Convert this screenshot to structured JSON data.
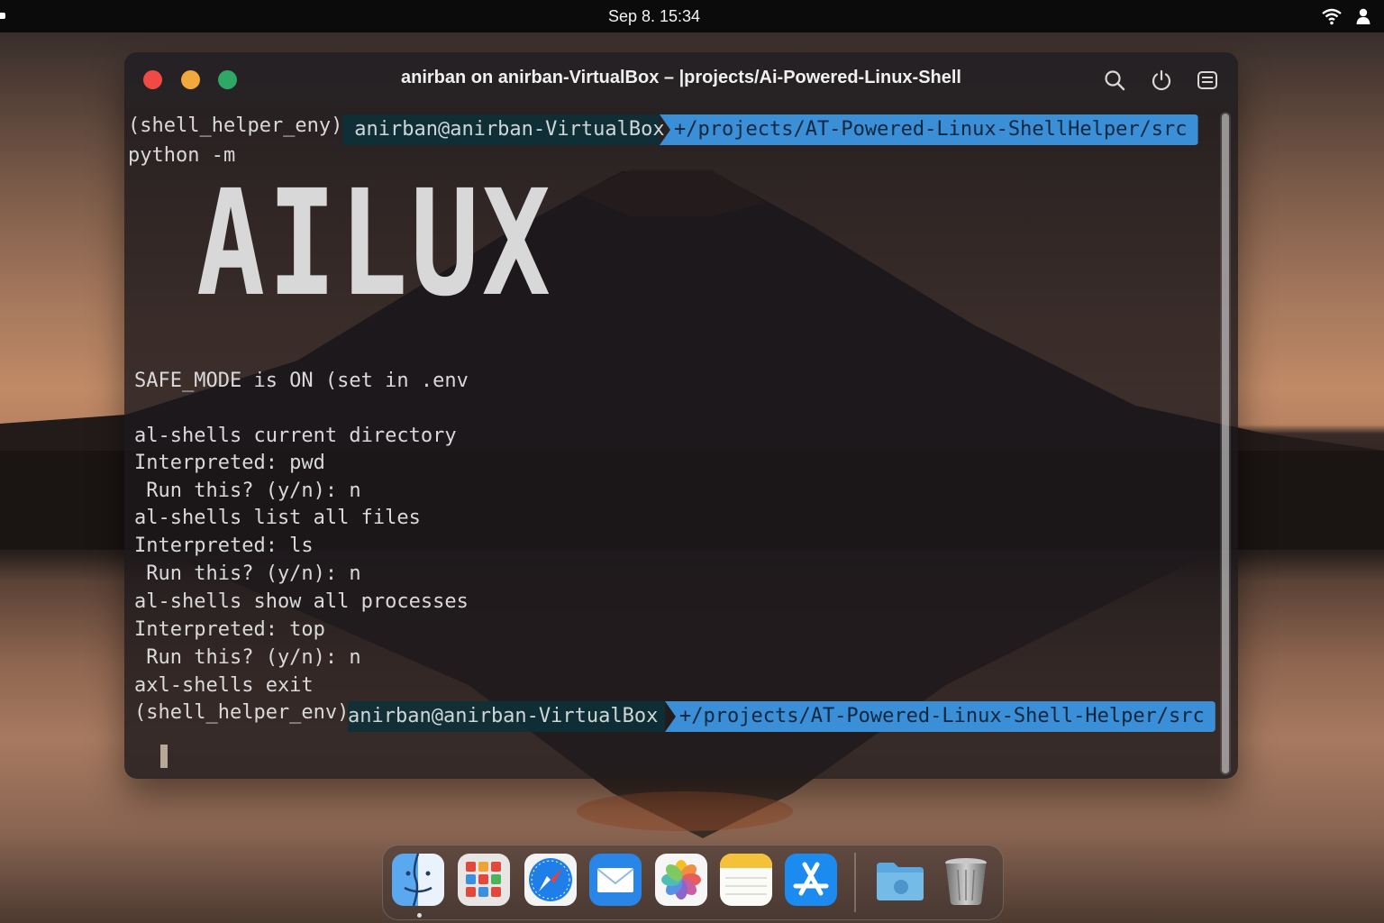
{
  "topbar": {
    "clock": "Sep 8. 15:34",
    "icons": [
      "wifi-icon",
      "user-icon"
    ]
  },
  "window": {
    "title": "anirban on anirban-VirtualBox  – |projects/Ai-Powered-Linux-Shell",
    "buttons": [
      "close",
      "minimize",
      "maximize"
    ],
    "toolbar_icons": [
      "search-icon",
      "power-icon",
      "menu-icon"
    ]
  },
  "terminal": {
    "prompt1": {
      "env": "(shell_helper_eny) ",
      "user": " anirban@anirban-VirtualBox ",
      "path": "+/projects/AT-Powered-Linux-ShellHelper/src"
    },
    "command": "python -m",
    "banner": "AILUX",
    "lines": [
      "SAFE_MODE is ON (set in .env",
      "",
      "al-shells current directory",
      "Interpreted: pwd",
      " Run this? (y/n): n",
      "al-shells list all files",
      "Interpreted: ls",
      " Run this? (y/n): n",
      "al-shells show all processes",
      "Interpreted: top",
      " Run this? (y/n): n",
      "axl-shells exit"
    ],
    "prompt2": {
      "env": "(shell_helper_env)",
      "user": "anirban@anirban-VirtualBox ",
      "path": "+/projects/AT-Powered-Linux-Shell-Helper/src"
    }
  },
  "dock": {
    "items": [
      "finder",
      "launchpad",
      "safari",
      "mail",
      "photos",
      "notes",
      "app-store",
      "folder",
      "trash"
    ],
    "colors": {
      "finder": "#3c8fe0",
      "safari": "#1f7fe8",
      "mail": "#2a86e6",
      "appstore": "#1c8bf0",
      "notes": "#f3c23a"
    }
  }
}
